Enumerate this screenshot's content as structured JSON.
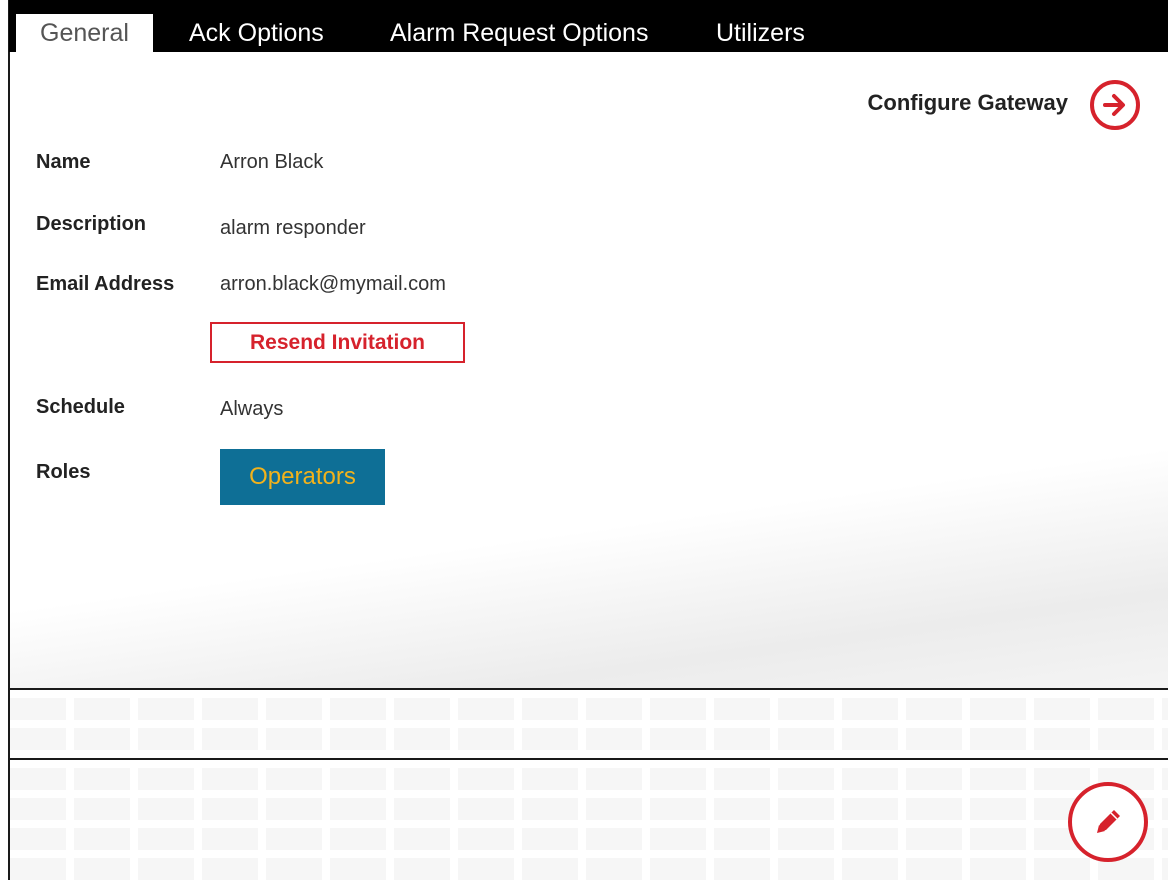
{
  "tabs": [
    {
      "label": "General",
      "active": true
    },
    {
      "label": "Ack Options",
      "active": false
    },
    {
      "label": "Alarm Request Options",
      "active": false
    },
    {
      "label": "Utilizers",
      "active": false
    }
  ],
  "configure_gateway": {
    "label": "Configure Gateway",
    "icon": "arrow-right-circle-icon"
  },
  "fields": {
    "name": {
      "label": "Name",
      "value": "Arron Black"
    },
    "description": {
      "label": "Description",
      "value": "alarm responder"
    },
    "email": {
      "label": "Email Address",
      "value": "arron.black@mymail.com"
    },
    "schedule": {
      "label": "Schedule",
      "value": "Always"
    },
    "roles": {
      "label": "Roles",
      "items": [
        "Operators"
      ]
    }
  },
  "resend_invitation": {
    "label": "Resend Invitation"
  },
  "edit_button": {
    "icon": "pencil-icon"
  },
  "colors": {
    "accent_red": "#d6222c",
    "role_chip_bg": "#0e6f96",
    "role_chip_text": "#f2b21b",
    "tabbar_bg": "#000000"
  }
}
